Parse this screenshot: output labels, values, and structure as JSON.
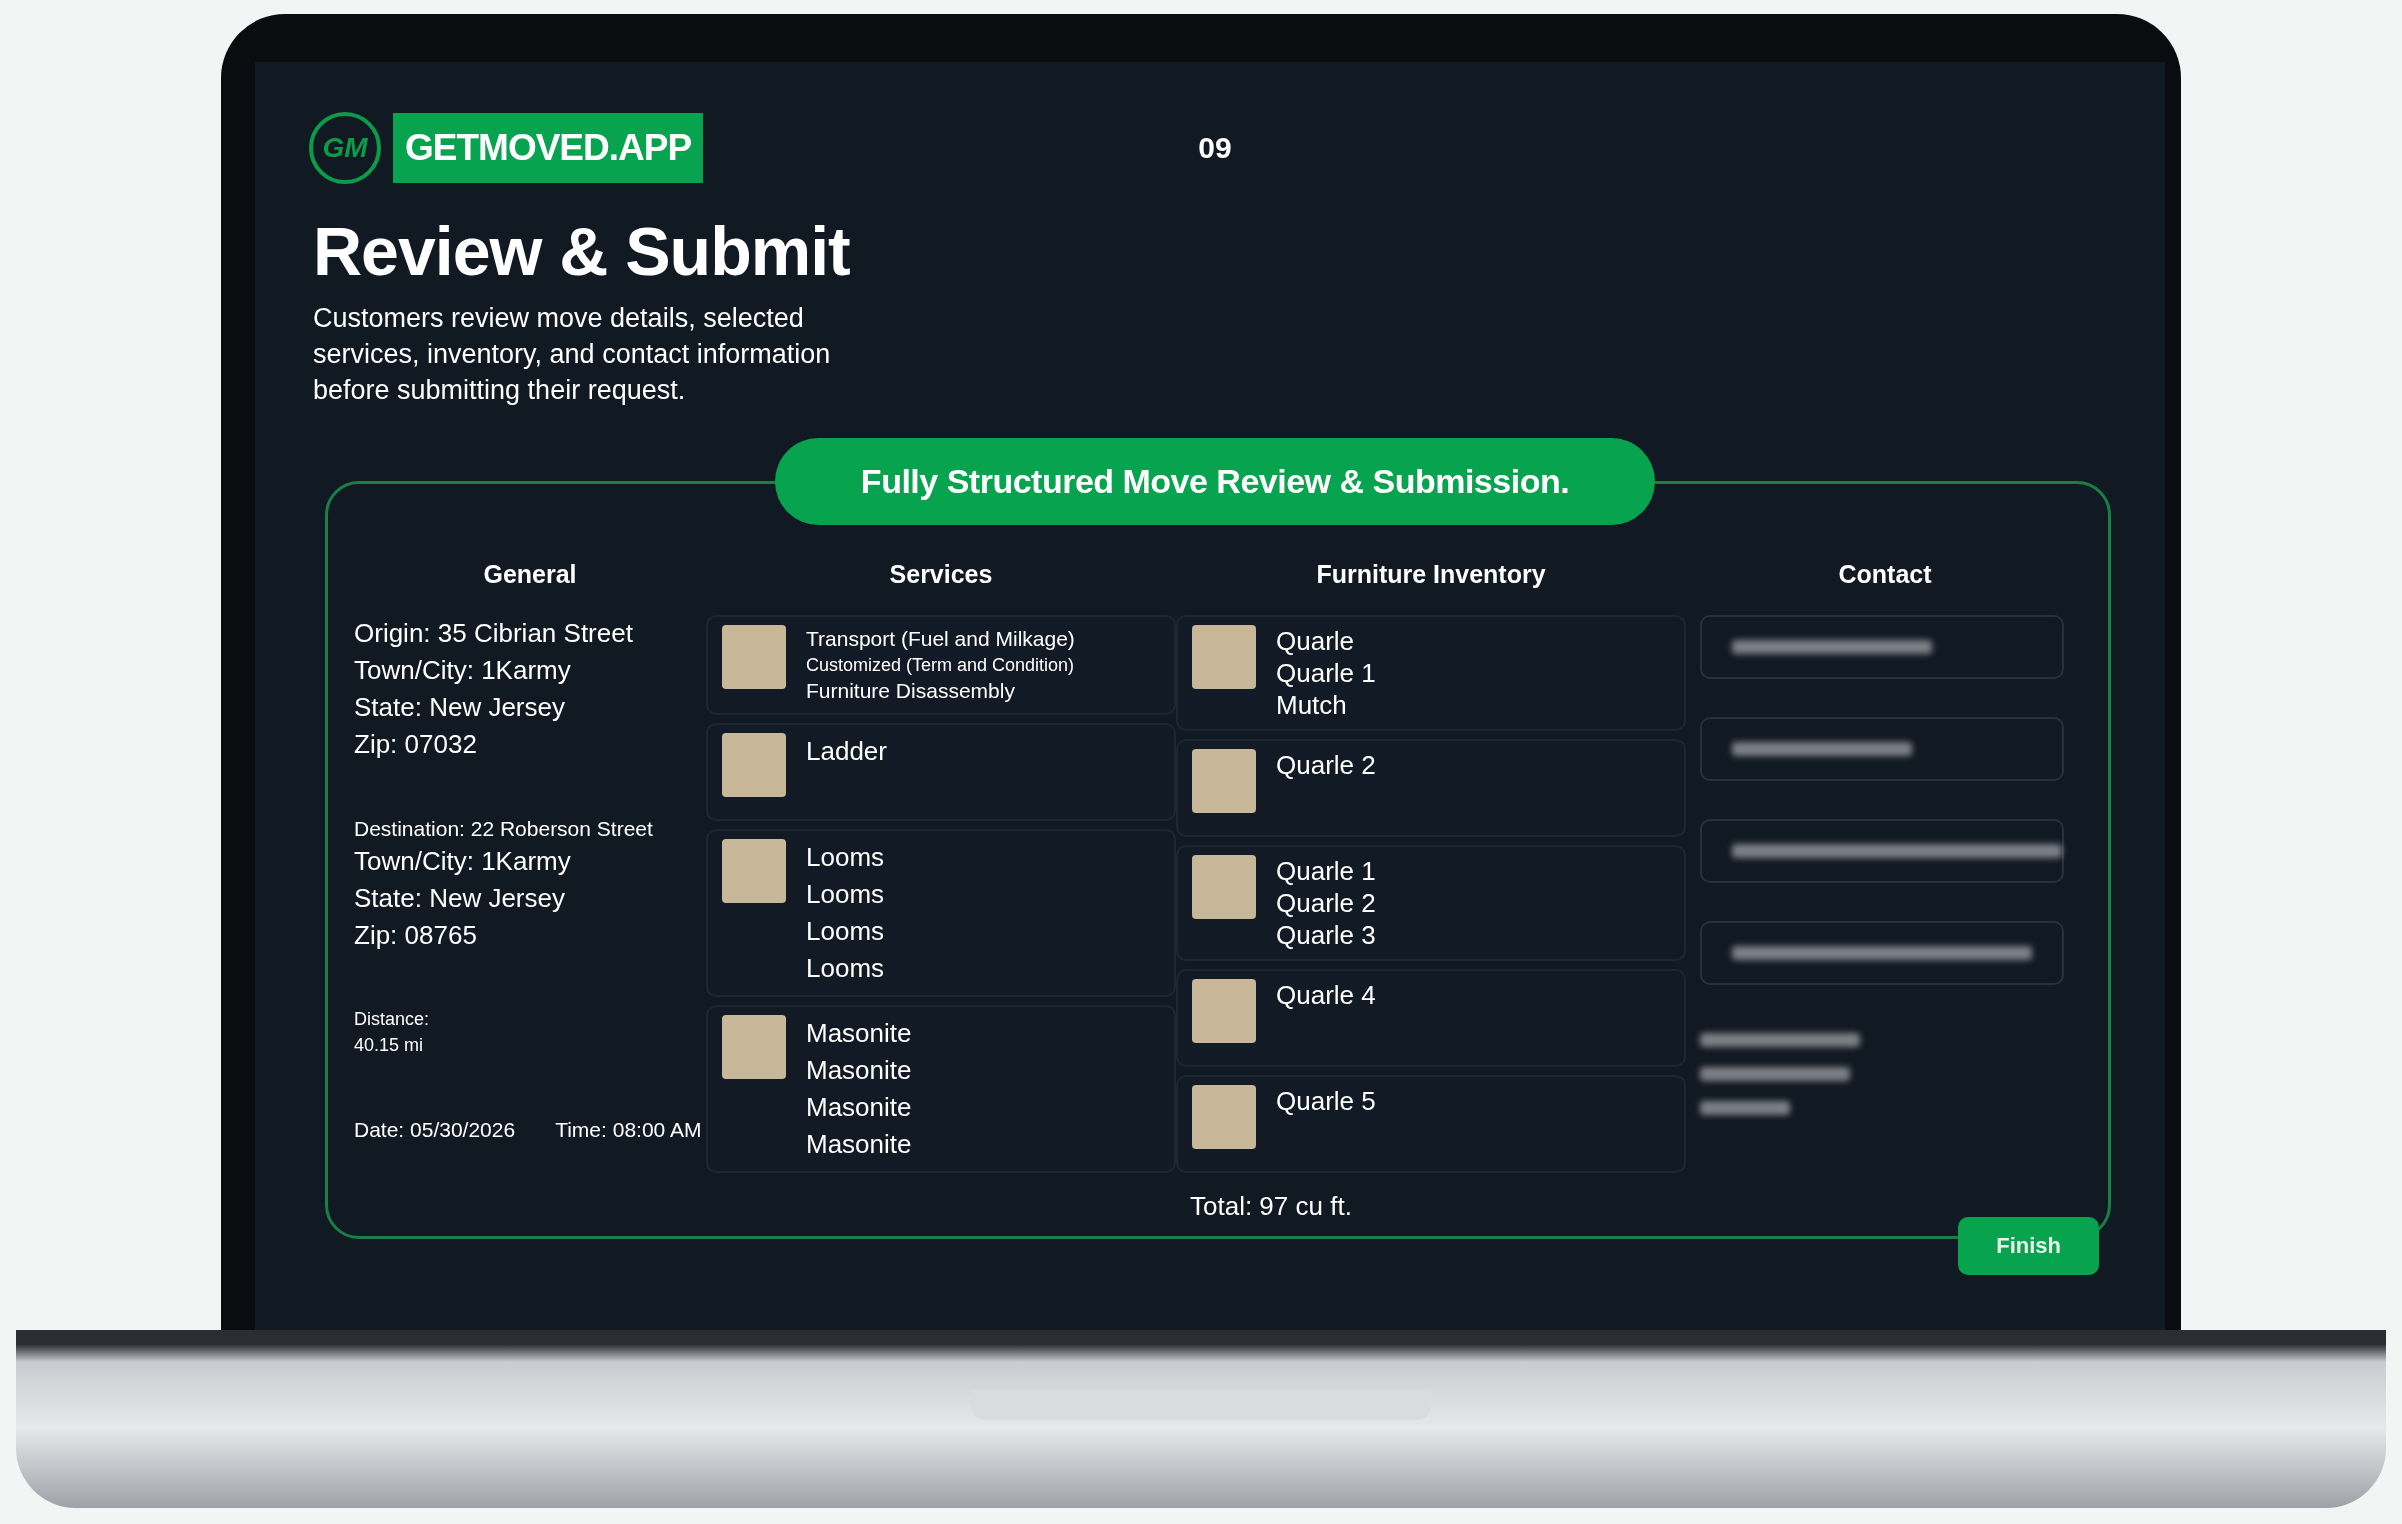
{
  "header": {
    "logo_mark": "GM",
    "brand": "GETMOVED.APP",
    "page_number": "09"
  },
  "title": "Review & Submit",
  "description": "Customers review move details, selected services, inventory, and contact information before submitting their request.",
  "banner": "Fully Structured Move Review & Submission.",
  "general": {
    "heading": "General",
    "groups": [
      {
        "lines": [
          {
            "text": "Origin: 35 Cibrian Street",
            "kind": "large"
          },
          {
            "text": "Town/City: 1Karmy",
            "kind": "large"
          },
          {
            "text": "State: New Jersey",
            "kind": "large"
          },
          {
            "text": "Zip: 07032",
            "kind": "large"
          }
        ]
      },
      {
        "lines": [
          {
            "text": "Destination: 22 Roberson Street",
            "kind": "small"
          },
          {
            "text": "Town/City: 1Karmy",
            "kind": "large"
          },
          {
            "text": "State: New Jersey",
            "kind": "large"
          },
          {
            "text": "Zip: 08765",
            "kind": "large"
          }
        ]
      }
    ],
    "distance": "Distance: 40.15 mi",
    "date": "Date: 05/30/2026",
    "time": "Time: 08:00 AM"
  },
  "services": {
    "heading": "Services",
    "cards": [
      {
        "lines": [
          {
            "text": "Transport (Fuel and Milkage)",
            "kind": "small"
          },
          {
            "text": "Customized (Term and Condition)",
            "kind": "tiny"
          },
          {
            "text": "Furniture Disassembly",
            "kind": "small"
          }
        ]
      },
      {
        "lines": [
          {
            "text": "Ladder",
            "kind": "large"
          }
        ]
      },
      {
        "lines": [
          {
            "text": "Looms",
            "kind": "large"
          },
          {
            "text": "Looms",
            "kind": "large"
          },
          {
            "text": "Looms",
            "kind": "large"
          },
          {
            "text": "Looms",
            "kind": "large"
          }
        ]
      },
      {
        "lines": [
          {
            "text": "Masonite",
            "kind": "large"
          },
          {
            "text": "Masonite",
            "kind": "large"
          },
          {
            "text": "Masonite",
            "kind": "large"
          },
          {
            "text": "Masonite",
            "kind": "large"
          }
        ]
      }
    ]
  },
  "inventory": {
    "heading": "Furniture Inventory",
    "cards": [
      {
        "lines": [
          "Quarle",
          "Quarle 1",
          "Mutch"
        ]
      },
      {
        "lines": [
          "Quarle 2"
        ]
      },
      {
        "lines": [
          "Quarle 1",
          "Quarle 2",
          "Quarle 3"
        ]
      },
      {
        "lines": [
          "Quarle 4"
        ]
      },
      {
        "lines": [
          "Quarle 5"
        ]
      }
    ],
    "total": "Total: 97 cu ft."
  },
  "contact": {
    "heading": "Contact"
  },
  "finish_button": "Finish"
}
